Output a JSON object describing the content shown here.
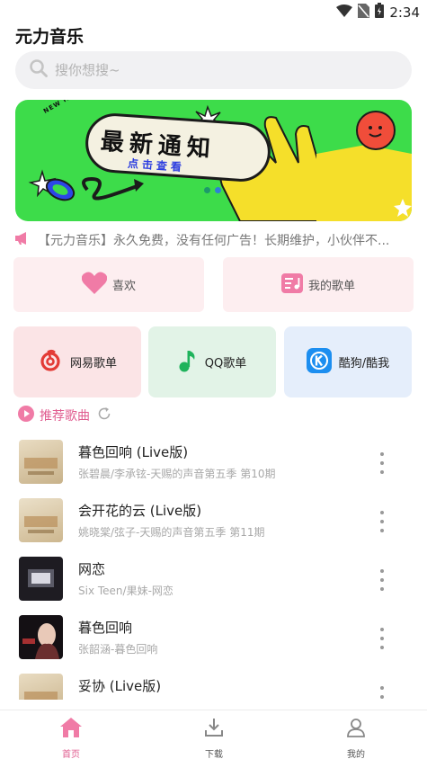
{
  "status": {
    "time": "2:34"
  },
  "app": {
    "title": "元力音乐"
  },
  "search": {
    "placeholder": "搜你想搜~"
  },
  "banner": {
    "title": "最新通知",
    "subtitle": "点击查看",
    "tag": "NEW INFORMATION"
  },
  "notice": {
    "text": "【元力音乐】永久免费，没有任何广告！长期维护，小伙伴不..."
  },
  "quick": {
    "like": "喜欢",
    "my_playlists": "我的歌单"
  },
  "sources": {
    "netease": "网易歌单",
    "qq": "QQ歌单",
    "kugou": "酷狗/酷我"
  },
  "recommend": {
    "label": "推荐歌曲"
  },
  "songs": [
    {
      "title": "暮色回响 (Live版)",
      "subtitle": "张碧晨/李承铉-天赐的声音第五季 第10期"
    },
    {
      "title": "会开花的云 (Live版)",
      "subtitle": "姚晓棠/弦子-天赐的声音第五季 第11期"
    },
    {
      "title": "网恋",
      "subtitle": "Six Teen/果妹-网恋"
    },
    {
      "title": "暮色回响",
      "subtitle": "张韶涵-暮色回响"
    },
    {
      "title": "妥协 (Live版)",
      "subtitle": ""
    }
  ],
  "tabs": {
    "home": "首页",
    "download": "下载",
    "me": "我的"
  },
  "colors": {
    "accent": "#e05c8f",
    "banner_bg": "#3ddc4a"
  }
}
